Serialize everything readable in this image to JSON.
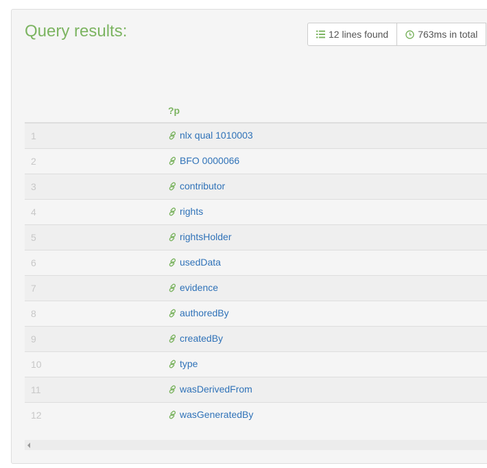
{
  "header": {
    "title": "Query results:",
    "lines_found": "12 lines found",
    "time_total": "763ms in total"
  },
  "icons": {
    "lines": "list-icon",
    "time": "clock-icon",
    "link": "link-icon"
  },
  "colors": {
    "accent_green": "#7cb461",
    "link_blue": "#2f72b8",
    "index_gray": "#c7c7c7"
  },
  "table": {
    "headers": [
      "",
      "?p"
    ],
    "rows": [
      {
        "index": "1",
        "value": "nlx qual 1010003"
      },
      {
        "index": "2",
        "value": "BFO 0000066"
      },
      {
        "index": "3",
        "value": "contributor"
      },
      {
        "index": "4",
        "value": "rights"
      },
      {
        "index": "5",
        "value": "rightsHolder"
      },
      {
        "index": "6",
        "value": "usedData"
      },
      {
        "index": "7",
        "value": "evidence"
      },
      {
        "index": "8",
        "value": "authoredBy"
      },
      {
        "index": "9",
        "value": "createdBy"
      },
      {
        "index": "10",
        "value": "type"
      },
      {
        "index": "11",
        "value": "wasDerivedFrom"
      },
      {
        "index": "12",
        "value": "wasGeneratedBy"
      }
    ]
  }
}
